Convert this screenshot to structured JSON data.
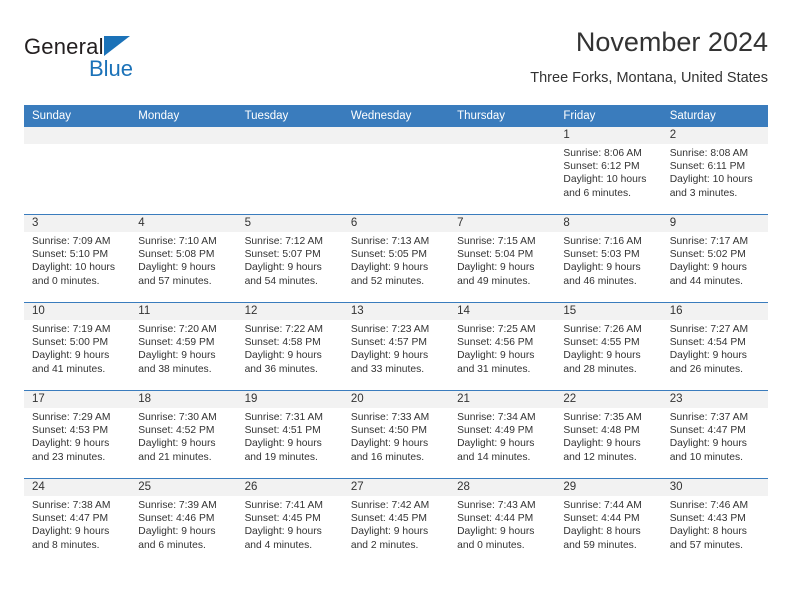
{
  "brand": {
    "name_part1": "General",
    "name_part2": "Blue",
    "accent_color": "#1b72b8"
  },
  "header": {
    "title": "November 2024",
    "subtitle": "Three Forks, Montana, United States"
  },
  "calendar": {
    "header_bg_color": "#3a7cbd",
    "daynum_bg_color": "#f2f2f2",
    "weekday_headers": [
      "Sunday",
      "Monday",
      "Tuesday",
      "Wednesday",
      "Thursday",
      "Friday",
      "Saturday"
    ],
    "weeks": [
      [
        {
          "day": "",
          "blank": true
        },
        {
          "day": "",
          "blank": true
        },
        {
          "day": "",
          "blank": true
        },
        {
          "day": "",
          "blank": true
        },
        {
          "day": "",
          "blank": true
        },
        {
          "day": "1",
          "sunrise": "Sunrise: 8:06 AM",
          "sunset": "Sunset: 6:12 PM",
          "daylight1": "Daylight: 10 hours",
          "daylight2": "and 6 minutes."
        },
        {
          "day": "2",
          "sunrise": "Sunrise: 8:08 AM",
          "sunset": "Sunset: 6:11 PM",
          "daylight1": "Daylight: 10 hours",
          "daylight2": "and 3 minutes."
        }
      ],
      [
        {
          "day": "3",
          "sunrise": "Sunrise: 7:09 AM",
          "sunset": "Sunset: 5:10 PM",
          "daylight1": "Daylight: 10 hours",
          "daylight2": "and 0 minutes."
        },
        {
          "day": "4",
          "sunrise": "Sunrise: 7:10 AM",
          "sunset": "Sunset: 5:08 PM",
          "daylight1": "Daylight: 9 hours",
          "daylight2": "and 57 minutes."
        },
        {
          "day": "5",
          "sunrise": "Sunrise: 7:12 AM",
          "sunset": "Sunset: 5:07 PM",
          "daylight1": "Daylight: 9 hours",
          "daylight2": "and 54 minutes."
        },
        {
          "day": "6",
          "sunrise": "Sunrise: 7:13 AM",
          "sunset": "Sunset: 5:05 PM",
          "daylight1": "Daylight: 9 hours",
          "daylight2": "and 52 minutes."
        },
        {
          "day": "7",
          "sunrise": "Sunrise: 7:15 AM",
          "sunset": "Sunset: 5:04 PM",
          "daylight1": "Daylight: 9 hours",
          "daylight2": "and 49 minutes."
        },
        {
          "day": "8",
          "sunrise": "Sunrise: 7:16 AM",
          "sunset": "Sunset: 5:03 PM",
          "daylight1": "Daylight: 9 hours",
          "daylight2": "and 46 minutes."
        },
        {
          "day": "9",
          "sunrise": "Sunrise: 7:17 AM",
          "sunset": "Sunset: 5:02 PM",
          "daylight1": "Daylight: 9 hours",
          "daylight2": "and 44 minutes."
        }
      ],
      [
        {
          "day": "10",
          "sunrise": "Sunrise: 7:19 AM",
          "sunset": "Sunset: 5:00 PM",
          "daylight1": "Daylight: 9 hours",
          "daylight2": "and 41 minutes."
        },
        {
          "day": "11",
          "sunrise": "Sunrise: 7:20 AM",
          "sunset": "Sunset: 4:59 PM",
          "daylight1": "Daylight: 9 hours",
          "daylight2": "and 38 minutes."
        },
        {
          "day": "12",
          "sunrise": "Sunrise: 7:22 AM",
          "sunset": "Sunset: 4:58 PM",
          "daylight1": "Daylight: 9 hours",
          "daylight2": "and 36 minutes."
        },
        {
          "day": "13",
          "sunrise": "Sunrise: 7:23 AM",
          "sunset": "Sunset: 4:57 PM",
          "daylight1": "Daylight: 9 hours",
          "daylight2": "and 33 minutes."
        },
        {
          "day": "14",
          "sunrise": "Sunrise: 7:25 AM",
          "sunset": "Sunset: 4:56 PM",
          "daylight1": "Daylight: 9 hours",
          "daylight2": "and 31 minutes."
        },
        {
          "day": "15",
          "sunrise": "Sunrise: 7:26 AM",
          "sunset": "Sunset: 4:55 PM",
          "daylight1": "Daylight: 9 hours",
          "daylight2": "and 28 minutes."
        },
        {
          "day": "16",
          "sunrise": "Sunrise: 7:27 AM",
          "sunset": "Sunset: 4:54 PM",
          "daylight1": "Daylight: 9 hours",
          "daylight2": "and 26 minutes."
        }
      ],
      [
        {
          "day": "17",
          "sunrise": "Sunrise: 7:29 AM",
          "sunset": "Sunset: 4:53 PM",
          "daylight1": "Daylight: 9 hours",
          "daylight2": "and 23 minutes."
        },
        {
          "day": "18",
          "sunrise": "Sunrise: 7:30 AM",
          "sunset": "Sunset: 4:52 PM",
          "daylight1": "Daylight: 9 hours",
          "daylight2": "and 21 minutes."
        },
        {
          "day": "19",
          "sunrise": "Sunrise: 7:31 AM",
          "sunset": "Sunset: 4:51 PM",
          "daylight1": "Daylight: 9 hours",
          "daylight2": "and 19 minutes."
        },
        {
          "day": "20",
          "sunrise": "Sunrise: 7:33 AM",
          "sunset": "Sunset: 4:50 PM",
          "daylight1": "Daylight: 9 hours",
          "daylight2": "and 16 minutes."
        },
        {
          "day": "21",
          "sunrise": "Sunrise: 7:34 AM",
          "sunset": "Sunset: 4:49 PM",
          "daylight1": "Daylight: 9 hours",
          "daylight2": "and 14 minutes."
        },
        {
          "day": "22",
          "sunrise": "Sunrise: 7:35 AM",
          "sunset": "Sunset: 4:48 PM",
          "daylight1": "Daylight: 9 hours",
          "daylight2": "and 12 minutes."
        },
        {
          "day": "23",
          "sunrise": "Sunrise: 7:37 AM",
          "sunset": "Sunset: 4:47 PM",
          "daylight1": "Daylight: 9 hours",
          "daylight2": "and 10 minutes."
        }
      ],
      [
        {
          "day": "24",
          "sunrise": "Sunrise: 7:38 AM",
          "sunset": "Sunset: 4:47 PM",
          "daylight1": "Daylight: 9 hours",
          "daylight2": "and 8 minutes."
        },
        {
          "day": "25",
          "sunrise": "Sunrise: 7:39 AM",
          "sunset": "Sunset: 4:46 PM",
          "daylight1": "Daylight: 9 hours",
          "daylight2": "and 6 minutes."
        },
        {
          "day": "26",
          "sunrise": "Sunrise: 7:41 AM",
          "sunset": "Sunset: 4:45 PM",
          "daylight1": "Daylight: 9 hours",
          "daylight2": "and 4 minutes."
        },
        {
          "day": "27",
          "sunrise": "Sunrise: 7:42 AM",
          "sunset": "Sunset: 4:45 PM",
          "daylight1": "Daylight: 9 hours",
          "daylight2": "and 2 minutes."
        },
        {
          "day": "28",
          "sunrise": "Sunrise: 7:43 AM",
          "sunset": "Sunset: 4:44 PM",
          "daylight1": "Daylight: 9 hours",
          "daylight2": "and 0 minutes."
        },
        {
          "day": "29",
          "sunrise": "Sunrise: 7:44 AM",
          "sunset": "Sunset: 4:44 PM",
          "daylight1": "Daylight: 8 hours",
          "daylight2": "and 59 minutes."
        },
        {
          "day": "30",
          "sunrise": "Sunrise: 7:46 AM",
          "sunset": "Sunset: 4:43 PM",
          "daylight1": "Daylight: 8 hours",
          "daylight2": "and 57 minutes."
        }
      ]
    ]
  }
}
